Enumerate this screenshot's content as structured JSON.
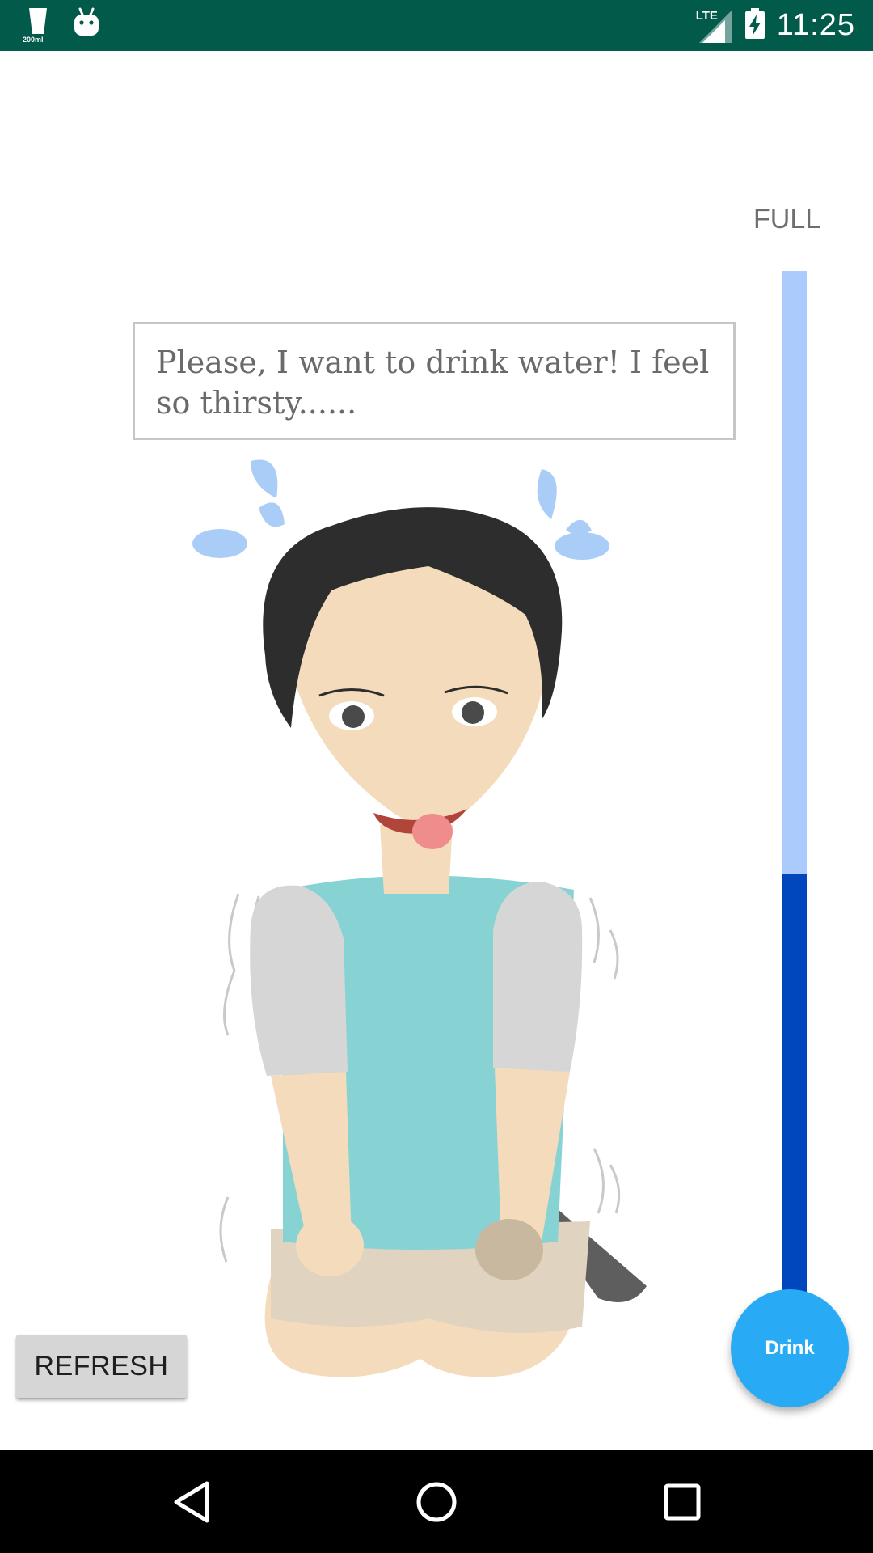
{
  "status_bar": {
    "time": "11:25",
    "network": "LTE",
    "notification_icons": [
      "water-cup-icon",
      "android-icon"
    ],
    "cup_label": "200ml",
    "background": "#025a4a"
  },
  "meter": {
    "label": "FULL",
    "level_fraction": 0.41,
    "empty_color": "#aacbfc",
    "fill_color": "#0047be"
  },
  "speech_bubble": {
    "text": "Please, I want to drink water! I feel so thirsty......"
  },
  "illustration": {
    "icon": "thirsty-boy-illustration"
  },
  "buttons": {
    "refresh": "REFRESH",
    "drink": "Drink",
    "drink_color": "#29aaf5"
  },
  "nav_bar": {
    "icons": [
      "back-icon",
      "home-icon",
      "recents-icon"
    ]
  }
}
